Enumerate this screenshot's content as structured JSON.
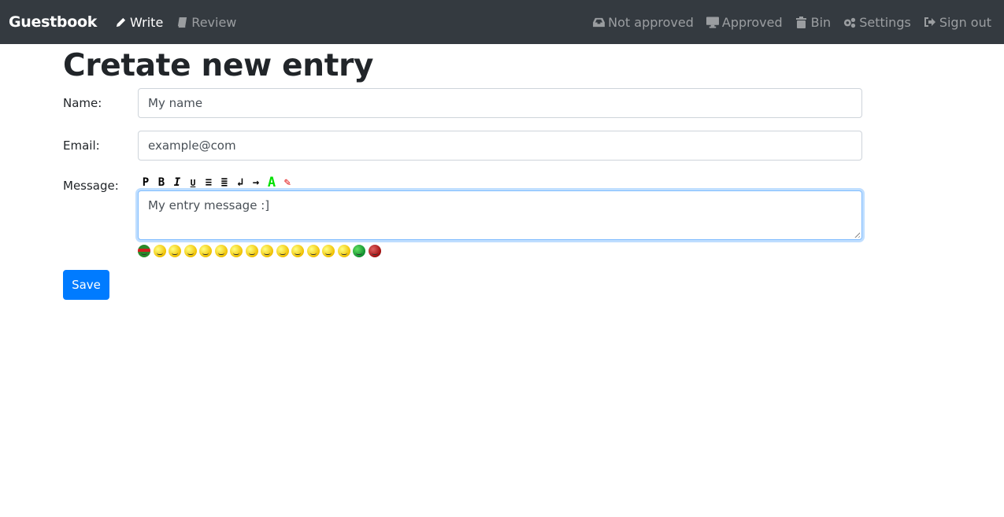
{
  "navbar": {
    "brand": "Guestbook",
    "left_links": [
      {
        "label": "Write",
        "icon": "pencil-icon",
        "active": true
      },
      {
        "label": "Review",
        "icon": "book-icon",
        "active": false
      }
    ],
    "right_links": [
      {
        "label": "Not approved",
        "icon": "inbox-icon"
      },
      {
        "label": "Approved",
        "icon": "desktop-icon"
      },
      {
        "label": "Bin",
        "icon": "trash-icon"
      },
      {
        "label": "Settings",
        "icon": "gears-icon"
      },
      {
        "label": "Sign out",
        "icon": "sign-out-icon"
      }
    ]
  },
  "page": {
    "title": "Cretate new entry",
    "form": {
      "name_label": "Name:",
      "name_value": "My name",
      "email_label": "Email:",
      "email_value": "example@com",
      "message_label": "Message:",
      "message_value": "My entry message :]",
      "toolbar": [
        {
          "name": "paragraph",
          "glyph": "P"
        },
        {
          "name": "bold",
          "glyph": "B"
        },
        {
          "name": "italic",
          "glyph": "I"
        },
        {
          "name": "underline",
          "glyph": "U"
        },
        {
          "name": "align-center",
          "glyph": "≡"
        },
        {
          "name": "align-right",
          "glyph": "≣"
        },
        {
          "name": "line-break",
          "glyph": "↲"
        },
        {
          "name": "indent",
          "glyph": "→"
        },
        {
          "name": "font-color",
          "glyph": "A"
        },
        {
          "name": "brush",
          "glyph": "✎"
        }
      ],
      "smileys": [
        "frog",
        "smile",
        "neutral",
        "neutral",
        "wink",
        "blush",
        "grin",
        "laugh",
        "eyes",
        "smile",
        "spots",
        "dead",
        "sad",
        "worried",
        "sick",
        "angry"
      ],
      "save_label": "Save"
    }
  },
  "colors": {
    "navbar_bg": "#343a40",
    "primary": "#007bff",
    "font_color_icon": "#00e000",
    "brush_tip": "#e00000"
  }
}
